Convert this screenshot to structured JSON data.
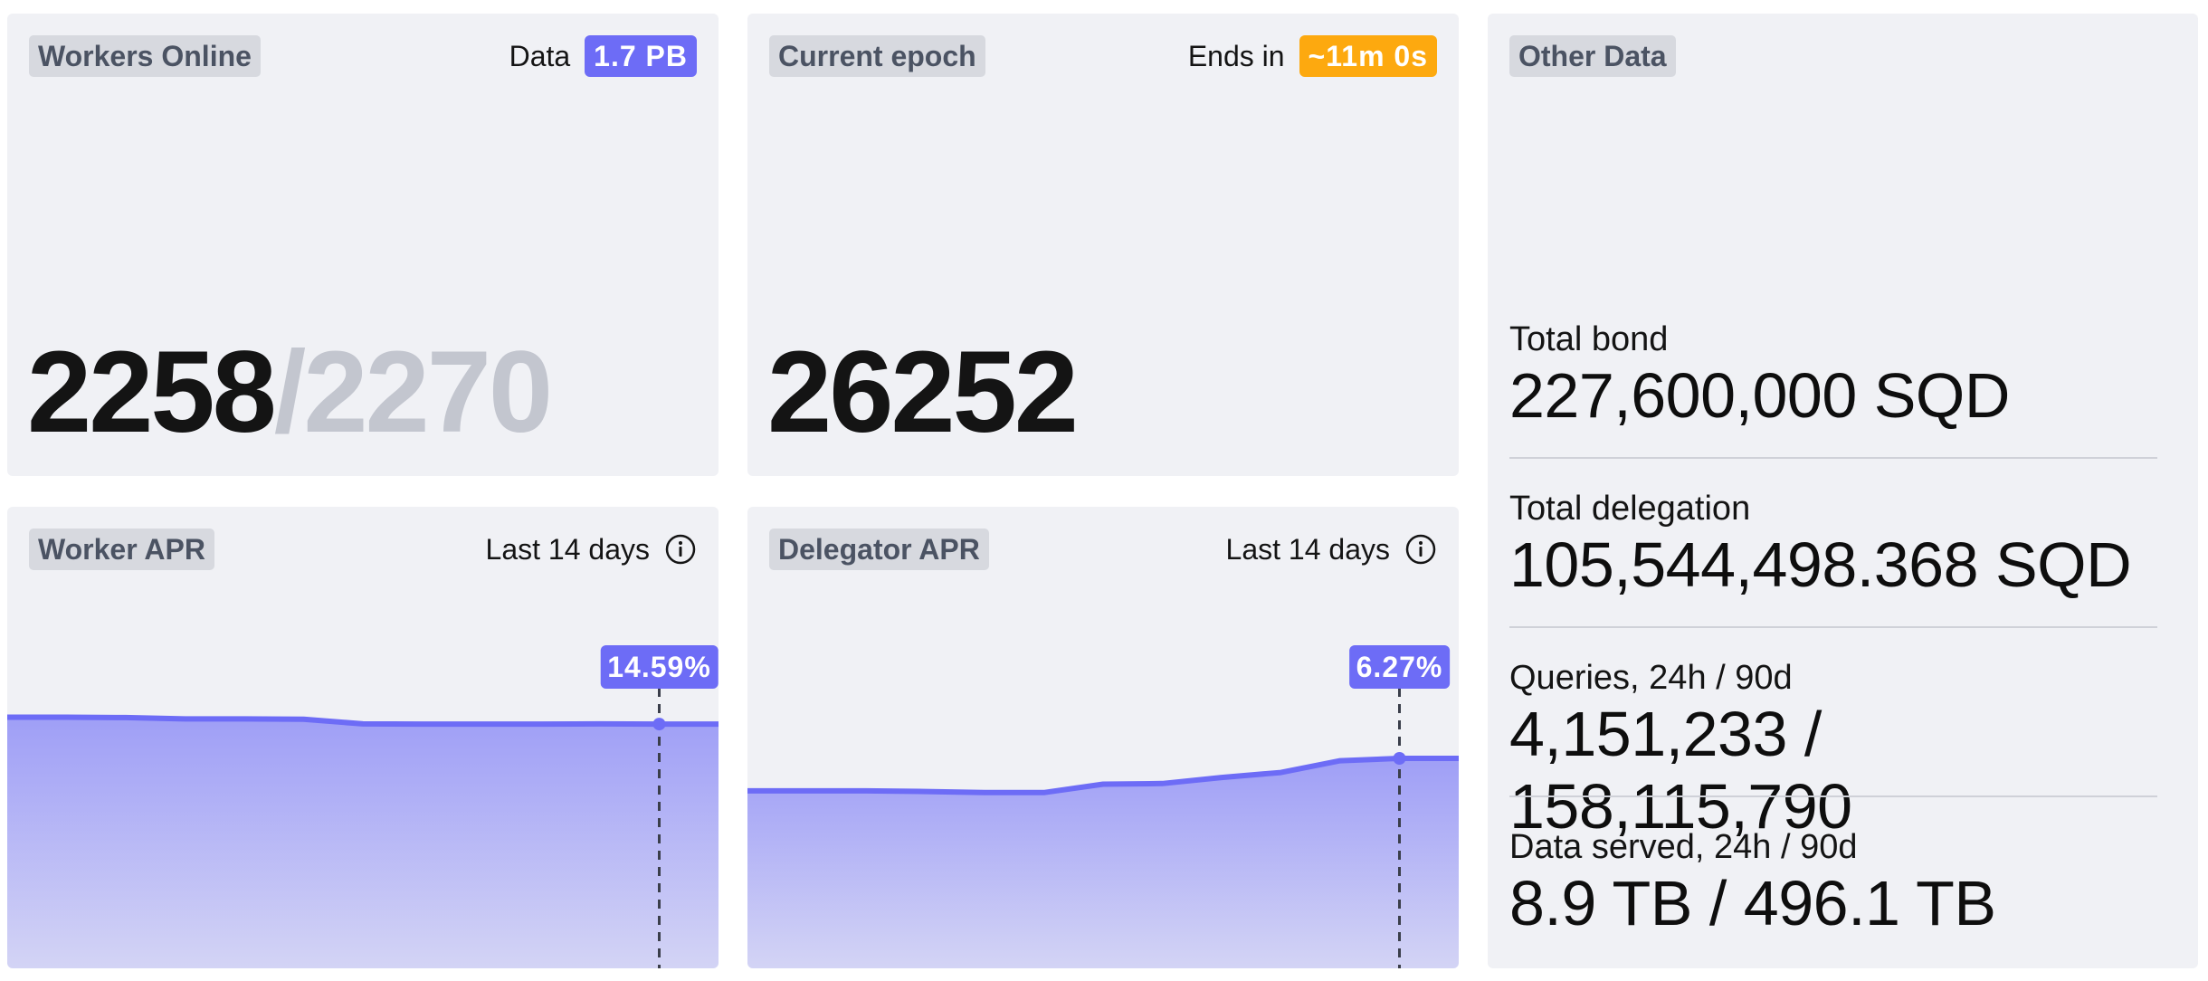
{
  "workers_card": {
    "tag": "Workers Online",
    "data_label": "Data",
    "data_value": "1.7 PB",
    "online": "2258",
    "separator_total": "/2270"
  },
  "epoch_card": {
    "tag": "Current epoch",
    "ends_label": "Ends in",
    "ends_value": "~11m 0s",
    "epoch": "26252"
  },
  "other_card": {
    "tag": "Other Data",
    "stats": [
      {
        "label": "Total bond",
        "value": "227,600,000 SQD"
      },
      {
        "label": "Total delegation",
        "value": "105,544,498.368 SQD"
      },
      {
        "label": "Queries, 24h / 90d",
        "value": "4,151,233 / 158,115,790"
      },
      {
        "label": "Data served, 24h / 90d",
        "value": "8.9 TB / 496.1 TB"
      }
    ]
  },
  "worker_apr": {
    "tag": "Worker APR",
    "range_label": "Last 14 days",
    "tooltip": "14.59%",
    "info_icon": "info-icon"
  },
  "delegator_apr": {
    "tag": "Delegator APR",
    "range_label": "Last 14 days",
    "tooltip": "6.27%",
    "info_icon": "info-icon"
  },
  "colors": {
    "accent": "#6d6cf6",
    "warning": "#fda90f",
    "card_bg": "#f0f1f5",
    "tag_bg": "#d7d9df"
  },
  "chart_data": [
    {
      "type": "area",
      "title": "Worker APR",
      "values": [
        15.0,
        15.0,
        14.98,
        14.9,
        14.9,
        14.88,
        14.6,
        14.59,
        14.59,
        14.59,
        14.6,
        14.59,
        14.59
      ],
      "highlight_index": 11,
      "ylim": [
        0,
        20
      ]
    },
    {
      "type": "area",
      "title": "Delegator APR",
      "values": [
        5.3,
        5.3,
        5.3,
        5.28,
        5.25,
        5.25,
        5.5,
        5.52,
        5.7,
        5.85,
        6.2,
        6.27,
        6.27
      ],
      "highlight_index": 11,
      "ylim": [
        0,
        10
      ]
    }
  ]
}
